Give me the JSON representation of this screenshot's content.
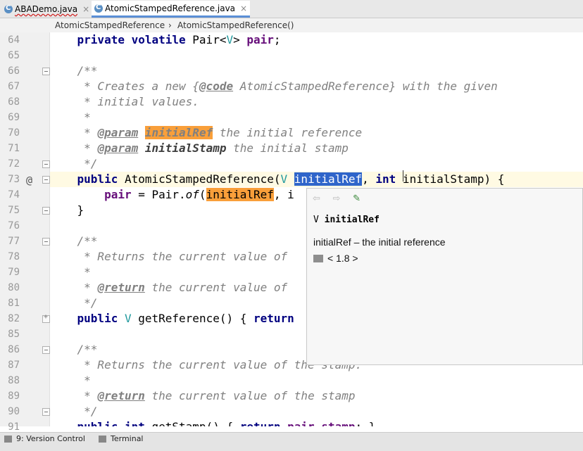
{
  "tabs": [
    {
      "label": "ABADemo.java",
      "close": "×"
    },
    {
      "label": "AtomicStampedReference.java",
      "close": "×"
    }
  ],
  "breadcrumb": [
    "AtomicStampedReference",
    "›",
    "AtomicStampedReference()"
  ],
  "gutter": {
    "line_numbers": [
      "64",
      "65",
      "66",
      "67",
      "68",
      "69",
      "70",
      "71",
      "72",
      "73",
      "74",
      "75",
      "76",
      "77",
      "78",
      "79",
      "80",
      "81",
      "82",
      "85",
      "86",
      "87",
      "88",
      "89",
      "90",
      "91"
    ],
    "at_marker": "@"
  },
  "code": {
    "l64": [
      "    ",
      "private volatile",
      " Pair<",
      "V",
      "> ",
      "pair",
      ";"
    ],
    "l66": "    /**",
    "l67a": "     * Creates a new {",
    "l67b": "@code",
    "l67c": " AtomicStampedReference} with the given",
    "l68": "     * initial values.",
    "l69": "     *",
    "l70a": "     * ",
    "l70b": "@param",
    "l70c": " ",
    "l70d": "initialRef",
    "l70e": " the initial reference",
    "l71a": "     * ",
    "l71b": "@param",
    "l71c": " ",
    "l71d": "initialStamp",
    "l71e": " the initial stamp",
    "l72": "     */",
    "l73a": "public",
    "l73b": " AtomicStampedReference(",
    "l73c": "V",
    "l73d": "initialRef",
    "l73e": ", ",
    "l73f": "int",
    "l73g": " initialStamp) {",
    "l74a": "        ",
    "l74b": "pair",
    "l74c": " = Pair.",
    "l74d": "of",
    "l74e": "(",
    "l74f": "initialRef",
    "l74g": ", i",
    "l75": "    }",
    "l77": "    /**",
    "l78": "     * Returns the current value of",
    "l79": "     *",
    "l80a": "     * ",
    "l80b": "@return",
    "l80c": " the current value of",
    "l81": "     */",
    "l82a": "public",
    "l82b": " ",
    "l82c": "V",
    "l82d": " getReference() { ",
    "l82e": "return",
    "l86": "    /**",
    "l87": "     * Returns the current value of the stamp.",
    "l88": "     *",
    "l89a": "     * ",
    "l89b": "@return",
    "l89c": " the current value of the stamp",
    "l90": "     */",
    "l91a": "public int",
    "l91b": " getStamp() { ",
    "l91c": "return",
    "l91d": " ",
    "l91e": "pair",
    "l91f": ".",
    "l91g": "stamp",
    "l91h": "; }"
  },
  "popup": {
    "back": "⇦",
    "forward": "⇨",
    "edit": "✎",
    "signature_type": "V",
    "signature_name": "initialRef",
    "description": "initialRef – the initial reference",
    "library": "< 1.8 >"
  },
  "status_bar": {
    "version_control": "9: Version Control",
    "terminal": "Terminal"
  },
  "colors": {
    "keyword": "#000080",
    "field": "#660e7a",
    "comment": "#808080",
    "type_param": "#20999d",
    "highlight_orange": "#f99f3a",
    "selection": "#2f65ca"
  }
}
